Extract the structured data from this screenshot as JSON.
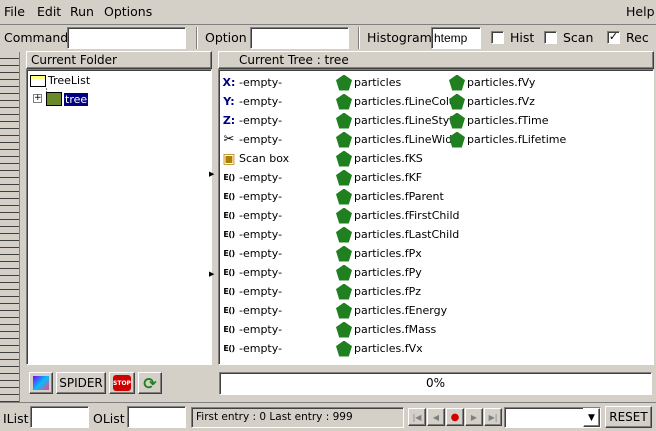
{
  "menu": {
    "file": "File",
    "edit": "Edit",
    "run": "Run",
    "options": "Options",
    "help": "Help"
  },
  "toolbar": {
    "command_label": "Command",
    "command_value": "",
    "option_label": "Option",
    "option_value": "",
    "histogram_label": "Histogram",
    "histogram_value": "htemp",
    "hist_label": "Hist",
    "hist_checked": false,
    "scan_label": "Scan",
    "scan_checked": false,
    "rec_label": "Rec",
    "rec_checked": true
  },
  "folder": {
    "header": "Current Folder",
    "root": "TreeList",
    "child": "tree"
  },
  "tree": {
    "header": "Current Tree : tree"
  },
  "col1": [
    {
      "icon": "x-axis-icon",
      "glyph": "X:",
      "label": "-empty-"
    },
    {
      "icon": "y-axis-icon",
      "glyph": "Y:",
      "label": "-empty-"
    },
    {
      "icon": "z-axis-icon",
      "glyph": "Z:",
      "label": "-empty-"
    },
    {
      "icon": "scissors-icon",
      "glyph": "✂",
      "label": "-empty-"
    },
    {
      "icon": "scan-box-icon",
      "glyph": "▣",
      "label": "Scan box"
    },
    {
      "icon": "expression-icon",
      "glyph": "E()",
      "label": "-empty-"
    },
    {
      "icon": "expression-icon",
      "glyph": "E()",
      "label": "-empty-"
    },
    {
      "icon": "expression-icon",
      "glyph": "E()",
      "label": "-empty-"
    },
    {
      "icon": "expression-icon",
      "glyph": "E()",
      "label": "-empty-"
    },
    {
      "icon": "expression-icon",
      "glyph": "E()",
      "label": "-empty-"
    },
    {
      "icon": "expression-icon",
      "glyph": "E()",
      "label": "-empty-"
    },
    {
      "icon": "expression-icon",
      "glyph": "E()",
      "label": "-empty-"
    },
    {
      "icon": "expression-icon",
      "glyph": "E()",
      "label": "-empty-"
    },
    {
      "icon": "expression-icon",
      "glyph": "E()",
      "label": "-empty-"
    },
    {
      "icon": "expression-icon",
      "glyph": "E()",
      "label": "-empty-"
    }
  ],
  "col2": [
    "particles",
    "particles.fLineColor",
    "particles.fLineStyle",
    "particles.fLineWidth",
    "particles.fKS",
    "particles.fKF",
    "particles.fParent",
    "particles.fFirstChild",
    "particles.fLastChild",
    "particles.fPx",
    "particles.fPy",
    "particles.fPz",
    "particles.fEnergy",
    "particles.fMass",
    "particles.fVx"
  ],
  "col3": [
    "particles.fVy",
    "particles.fVz",
    "particles.fTime",
    "particles.fLifetime"
  ],
  "buttons": {
    "spider": "SPIDER",
    "stop": "STOP",
    "reset": "RESET"
  },
  "progress": {
    "text": "0%",
    "value": 0
  },
  "status": {
    "ilist_label": "IList",
    "ilist_value": "",
    "olist_label": "OList",
    "olist_value": "",
    "entries": "First entry : 0 Last entry : 999"
  },
  "colors": {
    "select": "#000080",
    "leaf": "#208020",
    "stop": "#d00000"
  }
}
